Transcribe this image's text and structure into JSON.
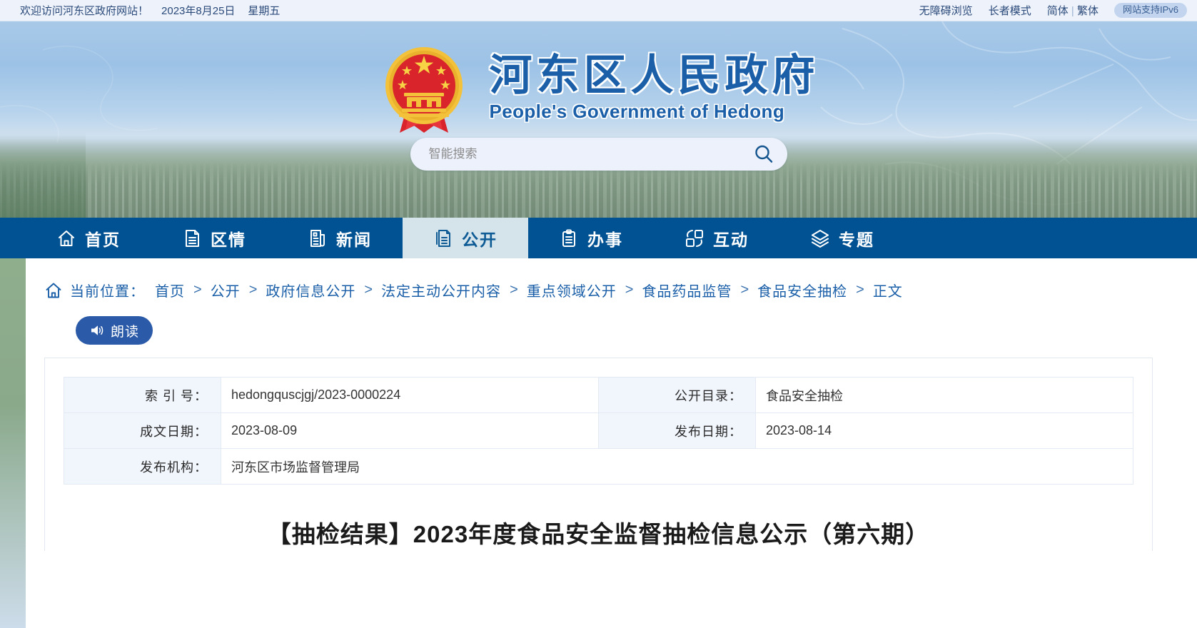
{
  "topbar": {
    "welcome": "欢迎访问河东区政府网站！",
    "date": "2023年8月25日",
    "weekday": "星期五",
    "links": [
      {
        "label": "无障碍浏览",
        "name": "accessibility-link"
      },
      {
        "label": "长者模式",
        "name": "elder-mode-link"
      },
      {
        "label": "简体",
        "name": "simplified-chinese-link"
      },
      {
        "label": "繁体",
        "name": "traditional-chinese-link"
      }
    ],
    "separator": "|",
    "ipv6_badge": "网站支持IPv6"
  },
  "brand": {
    "cn_title": "河东区人民政府",
    "en_title": "People's Government of Hedong",
    "emblem_name": "national-emblem"
  },
  "search": {
    "placeholder": "智能搜索",
    "value": "",
    "icon": "search-icon"
  },
  "nav": {
    "items": [
      {
        "label": "首页",
        "icon": "home-icon",
        "active": false
      },
      {
        "label": "区情",
        "icon": "document-icon",
        "active": false
      },
      {
        "label": "新闻",
        "icon": "news-icon",
        "active": false
      },
      {
        "label": "公开",
        "icon": "open-document-icon",
        "active": true
      },
      {
        "label": "办事",
        "icon": "clipboard-icon",
        "active": false
      },
      {
        "label": "互动",
        "icon": "interaction-icon",
        "active": false
      },
      {
        "label": "专题",
        "icon": "layers-icon",
        "active": false
      }
    ]
  },
  "breadcrumb": {
    "home_icon": "home-icon",
    "label": "当前位置：",
    "separator": ">",
    "items": [
      "首页",
      "公开",
      "政府信息公开",
      "法定主动公开内容",
      "重点领域公开",
      "食品药品监管",
      "食品安全抽检",
      "正文"
    ]
  },
  "read_button": {
    "label": "朗读",
    "icon": "speaker-icon"
  },
  "meta_table": {
    "rows": [
      [
        {
          "key": "索 引 号：",
          "value": "hedongquscjgj/2023-0000224"
        },
        {
          "key": "公开目录：",
          "value": "食品安全抽检"
        }
      ],
      [
        {
          "key": "成文日期：",
          "value": "2023-08-09"
        },
        {
          "key": "发布日期：",
          "value": "2023-08-14"
        }
      ],
      [
        {
          "key": "发布机构：",
          "value": "河东区市场监督管理局"
        },
        {
          "key": "",
          "value": ""
        }
      ]
    ]
  },
  "article": {
    "title": "【抽检结果】2023年度食品安全监督抽检信息公示（第六期）"
  },
  "colors": {
    "nav_blue": "#005293",
    "active_tab": "#d4e4ea",
    "link_blue": "#1a5fa8",
    "button_blue": "#2b5aa8",
    "topbar_bg": "#eef3fb"
  }
}
